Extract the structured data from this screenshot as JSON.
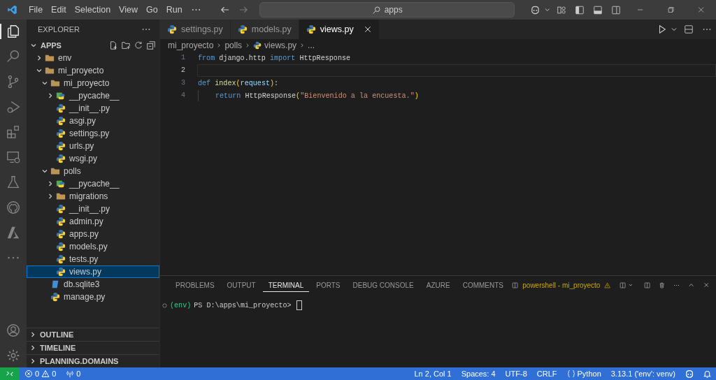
{
  "menu": [
    "File",
    "Edit",
    "Selection",
    "View",
    "Go",
    "Run"
  ],
  "search": {
    "value": "apps"
  },
  "explorer": {
    "title": "EXPLORER",
    "tree": [
      {
        "label": "APPS",
        "kind": "root",
        "expanded": true,
        "selected": false,
        "children": [
          {
            "label": "env",
            "kind": "folder",
            "expanded": false,
            "selected": false
          },
          {
            "label": "mi_proyecto",
            "kind": "folder",
            "expanded": true,
            "selected": false,
            "children": [
              {
                "label": "mi_proyecto",
                "kind": "folder",
                "expanded": true,
                "selected": false,
                "children": [
                  {
                    "label": "__pycache__",
                    "kind": "pycache",
                    "expanded": false,
                    "selected": false
                  },
                  {
                    "label": "__init__.py",
                    "kind": "python",
                    "selected": false
                  },
                  {
                    "label": "asgi.py",
                    "kind": "python",
                    "selected": false
                  },
                  {
                    "label": "settings.py",
                    "kind": "python",
                    "selected": false
                  },
                  {
                    "label": "urls.py",
                    "kind": "python",
                    "selected": false
                  },
                  {
                    "label": "wsgi.py",
                    "kind": "python",
                    "selected": false
                  }
                ]
              },
              {
                "label": "polls",
                "kind": "folder",
                "expanded": true,
                "selected": false,
                "children": [
                  {
                    "label": "__pycache__",
                    "kind": "pycache",
                    "expanded": false,
                    "selected": false
                  },
                  {
                    "label": "migrations",
                    "kind": "folder",
                    "expanded": false,
                    "selected": false
                  },
                  {
                    "label": "__init__.py",
                    "kind": "python",
                    "selected": false
                  },
                  {
                    "label": "admin.py",
                    "kind": "python",
                    "selected": false
                  },
                  {
                    "label": "apps.py",
                    "kind": "python",
                    "selected": false
                  },
                  {
                    "label": "models.py",
                    "kind": "python",
                    "selected": false
                  },
                  {
                    "label": "tests.py",
                    "kind": "python",
                    "selected": false
                  },
                  {
                    "label": "views.py",
                    "kind": "python",
                    "selected": true
                  }
                ]
              },
              {
                "label": "db.sqlite3",
                "kind": "database",
                "selected": false
              },
              {
                "label": "manage.py",
                "kind": "python",
                "selected": false
              }
            ]
          }
        ]
      }
    ],
    "sections": [
      {
        "label": "OUTLINE",
        "expanded": false
      },
      {
        "label": "TIMELINE",
        "expanded": false
      },
      {
        "label": "PLANNING.DOMAINS",
        "expanded": false
      }
    ]
  },
  "tabs": [
    {
      "label": "settings.py",
      "selected": false
    },
    {
      "label": "models.py",
      "selected": false
    },
    {
      "label": "views.py",
      "selected": true
    }
  ],
  "breadcrumb": [
    "mi_proyecto",
    "polls",
    "views.py",
    "..."
  ],
  "code": [
    {
      "number": "1",
      "current": false,
      "indented": false,
      "tokens": [
        {
          "text": "from",
          "kind": "keyword"
        },
        {
          "text": " django.http ",
          "kind": "plain"
        },
        {
          "text": "import",
          "kind": "keyword"
        },
        {
          "text": " HttpResponse",
          "kind": "plain"
        }
      ]
    },
    {
      "number": "2",
      "current": true,
      "indented": false
    },
    {
      "number": "3",
      "current": false,
      "indented": false,
      "tokens": [
        {
          "text": "def ",
          "kind": "keyword"
        },
        {
          "text": "index",
          "kind": "function"
        },
        {
          "text": "(",
          "kind": "bracket"
        },
        {
          "text": "request",
          "kind": "parameter"
        },
        {
          "text": ")",
          "kind": "bracket"
        },
        {
          "text": ":",
          "kind": "plain"
        }
      ]
    },
    {
      "number": "4",
      "current": false,
      "indented": true,
      "tokens": [
        {
          "text": "return",
          "kind": "keyword"
        },
        {
          "text": " HttpResponse",
          "kind": "plain"
        },
        {
          "text": "(",
          "kind": "bracket"
        },
        {
          "text": "\"Bienvenido a la encuesta.\"",
          "kind": "string"
        },
        {
          "text": ")",
          "kind": "bracket"
        }
      ]
    }
  ],
  "panel": {
    "tabs": [
      {
        "label": "PROBLEMS",
        "selected": false
      },
      {
        "label": "OUTPUT",
        "selected": false
      },
      {
        "label": "TERMINAL",
        "selected": true
      },
      {
        "label": "PORTS",
        "selected": false
      },
      {
        "label": "DEBUG CONSOLE",
        "selected": false
      },
      {
        "label": "AZURE",
        "selected": false
      },
      {
        "label": "COMMENTS",
        "selected": false
      }
    ],
    "terminal_name": "powershell - mi_proyecto",
    "env": "(env)",
    "prompt": "PS D:\\apps\\mi_proyecto>"
  },
  "status_bar": {
    "errors": "0",
    "warnings": "0",
    "ports": "0",
    "items": [
      {
        "label": "Ln 2, Col 1",
        "kind": "text"
      },
      {
        "label": "Spaces: 4",
        "kind": "text"
      },
      {
        "label": "UTF-8",
        "kind": "text"
      },
      {
        "label": "CRLF",
        "kind": "text"
      },
      {
        "label": "Python",
        "kind": "language"
      },
      {
        "label": "3.13.1 ('env': venv)",
        "kind": "text"
      }
    ]
  }
}
